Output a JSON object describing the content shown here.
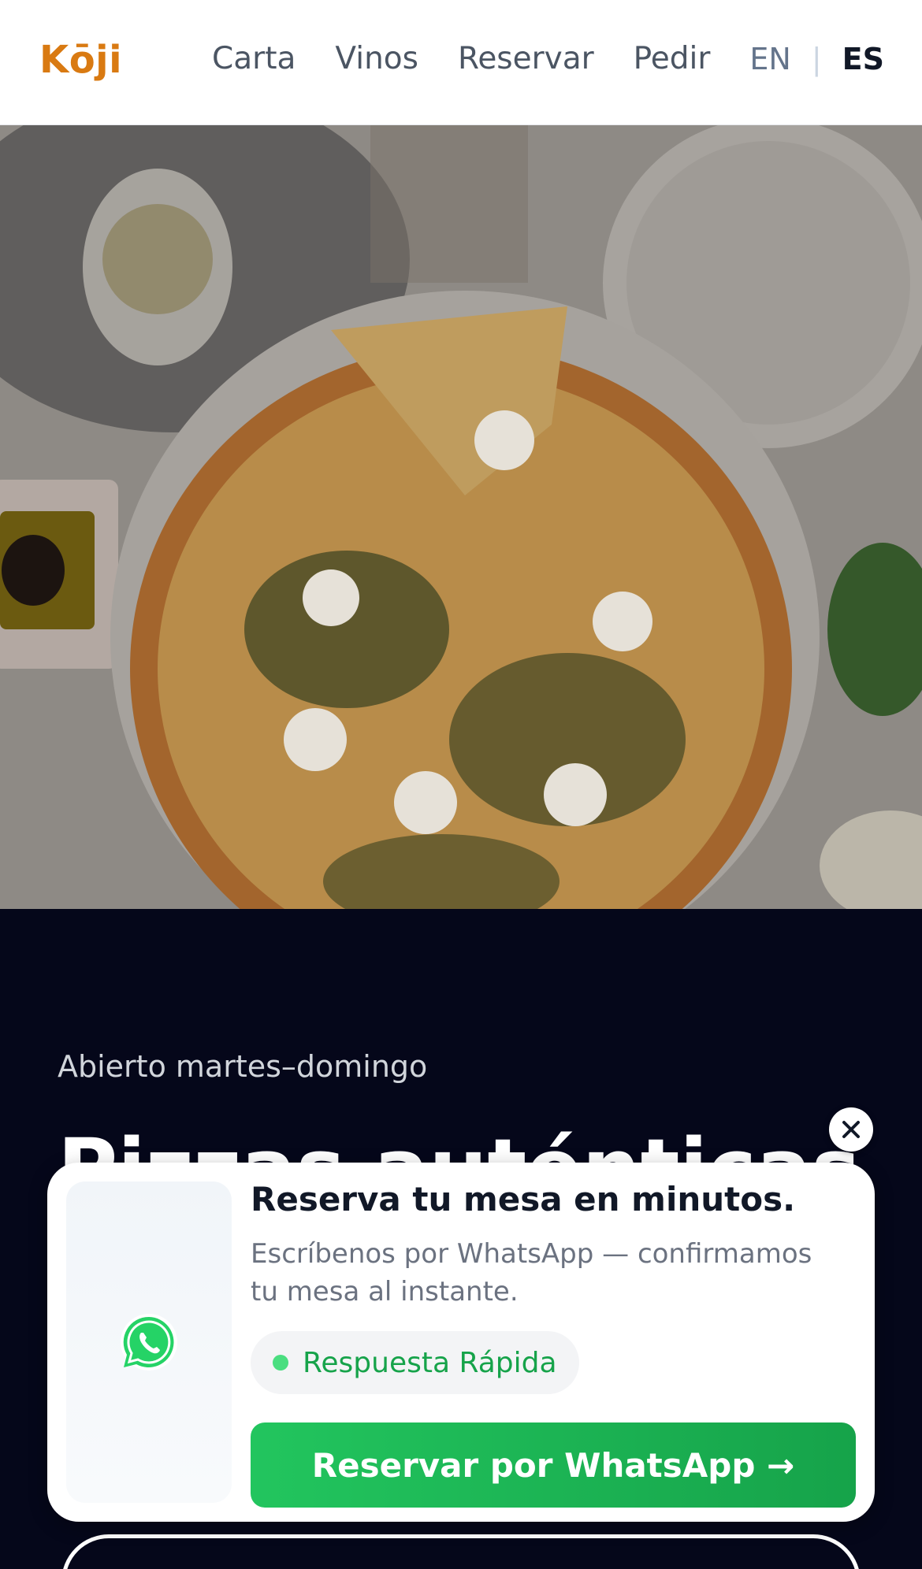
{
  "header": {
    "logo": "Kōji",
    "nav": [
      "Carta",
      "Vinos",
      "Reservar",
      "Pedir"
    ],
    "lang_en": "EN",
    "lang_sep": "|",
    "lang_es": "ES"
  },
  "hero": {
    "open_hours": "Abierto martes–domingo",
    "headline": "Pizzas auténticas"
  },
  "popup": {
    "title": "Reserva tu mesa en minutos.",
    "subtitle": "Escríbenos por WhatsApp — confirmamos tu mesa al instante.",
    "badge": "Respuesta Rápida",
    "cta": "Reservar por WhatsApp →"
  },
  "colors": {
    "brand": "#d97a12",
    "dark_bg": "#05071a",
    "whatsapp_green": "#22c55e"
  }
}
